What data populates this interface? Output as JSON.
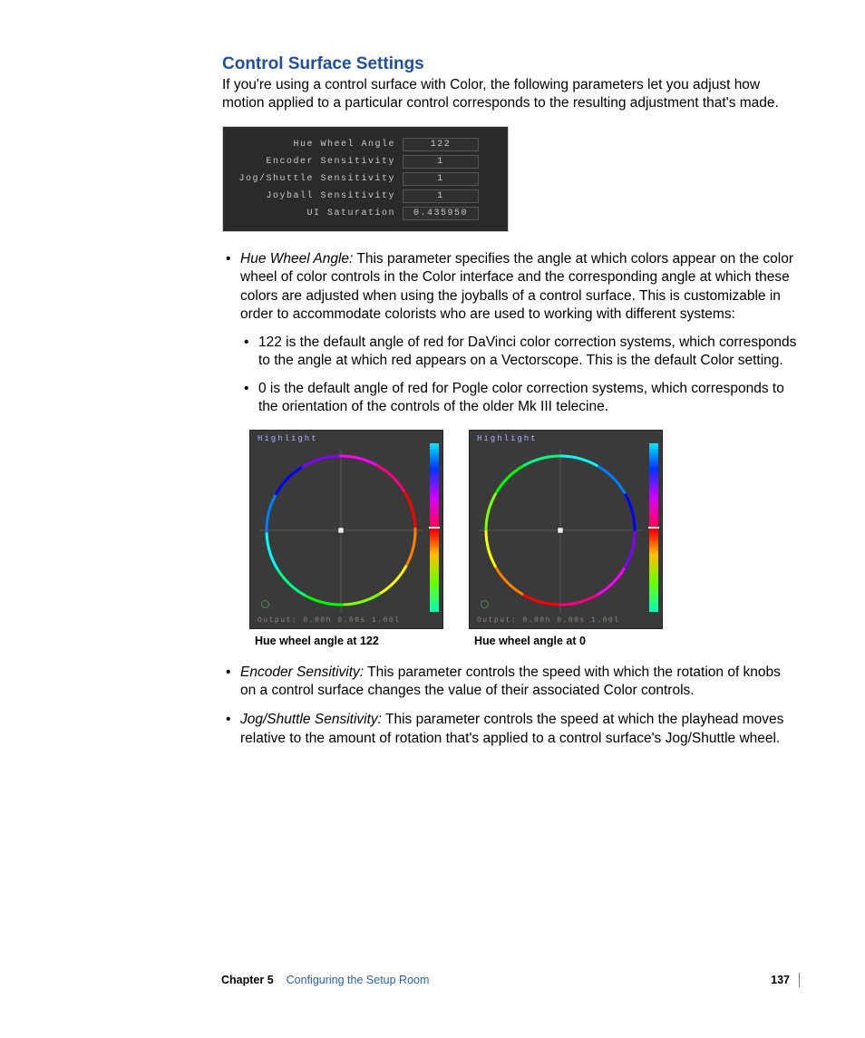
{
  "heading": "Control Surface Settings",
  "intro": "If you're using a control surface with Color, the following parameters let you adjust how motion applied to a particular control corresponds to the resulting adjustment that's made.",
  "settings": [
    {
      "label": "Hue Wheel Angle",
      "value": "122"
    },
    {
      "label": "Encoder Sensitivity",
      "value": "1"
    },
    {
      "label": "Jog/Shuttle Sensitivity",
      "value": "1"
    },
    {
      "label": "Joyball Sensitivity",
      "value": "1"
    },
    {
      "label": "UI Saturation",
      "value": "0.435950"
    }
  ],
  "bullets": {
    "hue_wheel": {
      "term": "Hue Wheel Angle:",
      "text": "  This parameter specifies the angle at which colors appear on the color wheel of color controls in the Color interface and the corresponding angle at which these colors are adjusted when using the joyballs of a control surface. This is customizable in order to accommodate colorists who are used to working with different systems:",
      "sub": [
        "122 is the default angle of red for DaVinci color correction systems, which corresponds to the angle at which red appears on a Vectorscope. This is the default Color setting.",
        "0 is the default angle of red for Pogle color correction systems, which corresponds to the orientation of the controls of the older Mk III telecine."
      ]
    },
    "encoder": {
      "term": "Encoder Sensitivity:",
      "text": "  This parameter controls the speed with which the rotation of knobs on a control surface changes the value of their associated Color controls."
    },
    "jog": {
      "term": "Jog/Shuttle Sensitivity:",
      "text": "  This parameter controls the speed at which the playhead moves relative to the amount of rotation that's applied to a control surface's Jog/Shuttle wheel."
    }
  },
  "wheel": {
    "highlight_label": "Highlight",
    "output_label": "Output: 0.00h 0.00s 1.00l",
    "caption1": "Hue wheel angle at 122",
    "caption2": "Hue wheel angle at 0"
  },
  "footer": {
    "chapter": "Chapter 5",
    "title": "Configuring the Setup Room",
    "page": "137"
  }
}
